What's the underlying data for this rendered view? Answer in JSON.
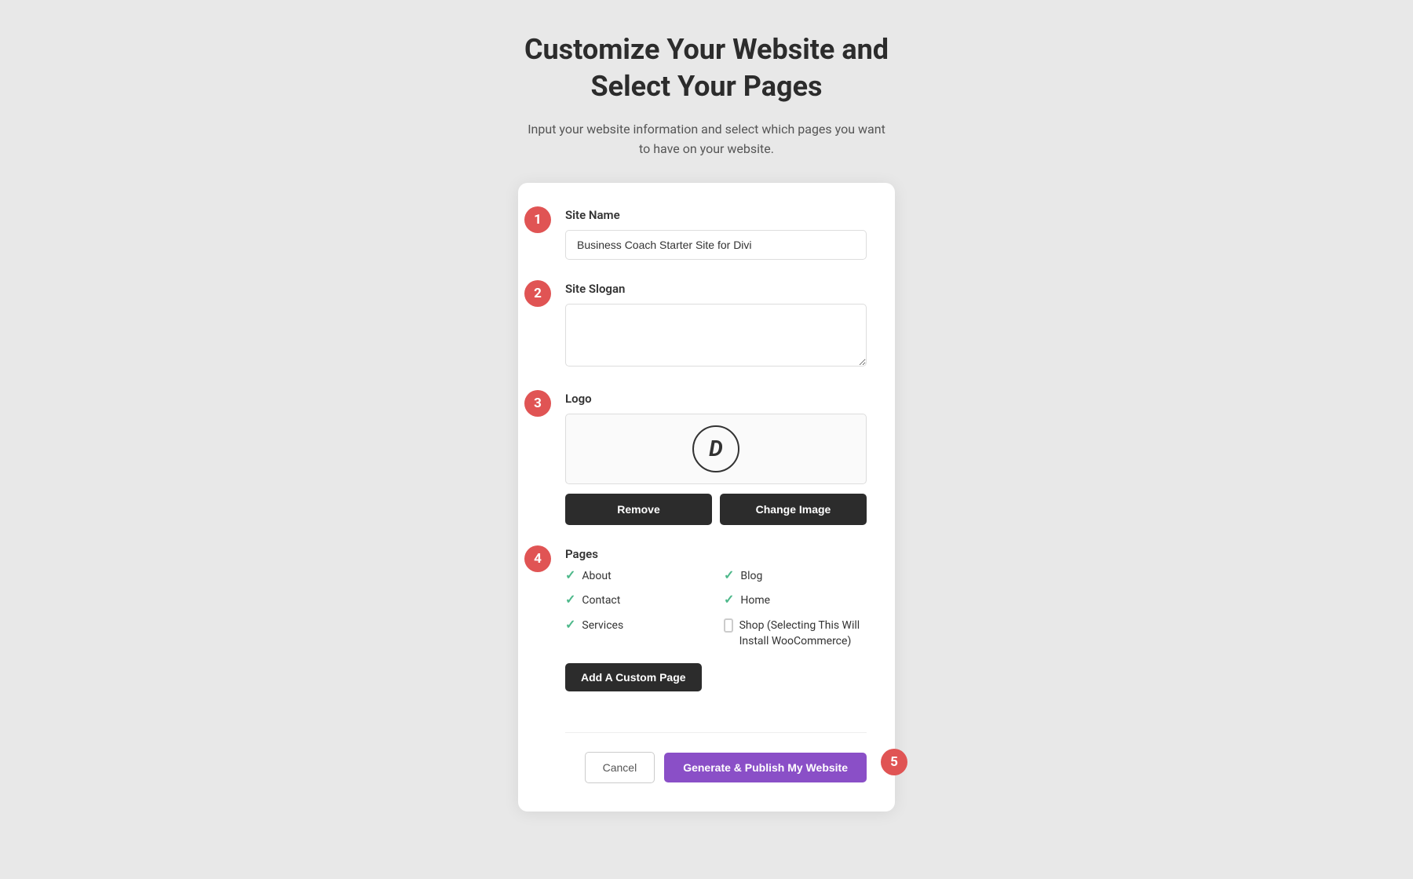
{
  "page": {
    "title_line1": "Customize Your Website and",
    "title_line2": "Select Your Pages",
    "subtitle": "Input your website information and select which pages you want to have on your website."
  },
  "steps": {
    "step1": "1",
    "step2": "2",
    "step3": "3",
    "step4": "4",
    "step5": "5"
  },
  "fields": {
    "site_name_label": "Site Name",
    "site_name_value": "Business Coach Starter Site for Divi",
    "site_slogan_label": "Site Slogan",
    "site_slogan_placeholder": "",
    "logo_label": "Logo",
    "logo_icon_text": "D",
    "pages_label": "Pages"
  },
  "buttons": {
    "remove": "Remove",
    "change_image": "Change Image",
    "add_custom_page": "Add A Custom Page",
    "cancel": "Cancel",
    "generate": "Generate & Publish My Website"
  },
  "pages": [
    {
      "name": "About",
      "checked": true,
      "column": 0
    },
    {
      "name": "Blog",
      "checked": true,
      "column": 1
    },
    {
      "name": "Contact",
      "checked": true,
      "column": 0
    },
    {
      "name": "Home",
      "checked": true,
      "column": 1
    },
    {
      "name": "Services",
      "checked": true,
      "column": 0
    },
    {
      "name": "Shop (Selecting This Will Install WooCommerce)",
      "checked": false,
      "column": 1
    }
  ]
}
